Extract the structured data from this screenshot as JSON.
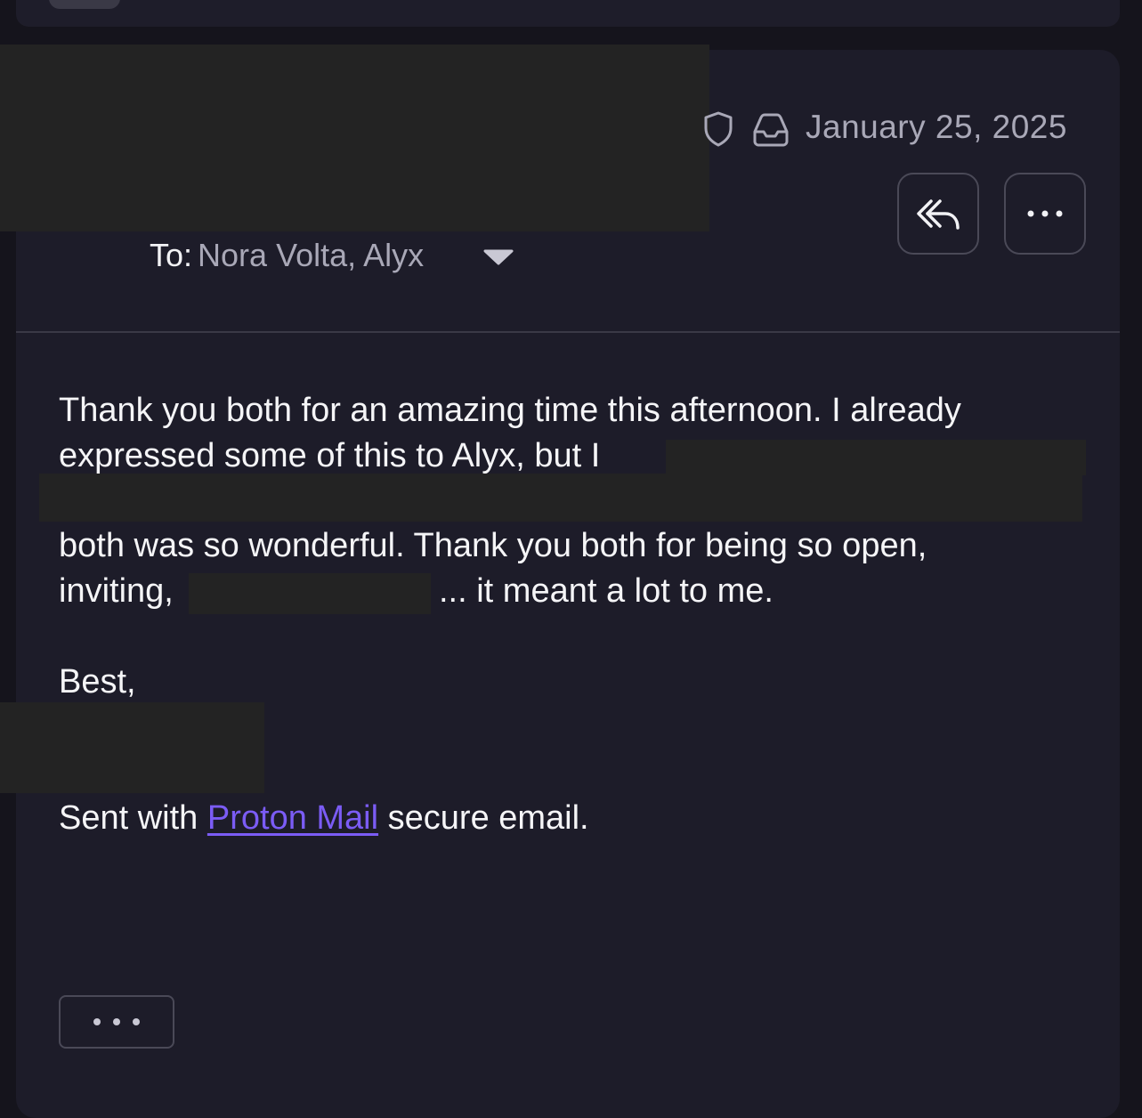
{
  "header": {
    "date": "January 25, 2025",
    "to_label": "To:",
    "to_names": "Nora Volta, Alyx"
  },
  "icons": {
    "shield": "shield-icon",
    "inbox": "inbox-icon",
    "reply_all": "reply-all-icon",
    "more": "more-horizontal-icon",
    "chevron": "chevron-down-icon"
  },
  "body": {
    "line1": "Thank you both for an amazing time this afternoon. I already",
    "line2": "expressed some of this to Alyx, but I",
    "line3": "both was so wonderful. Thank you both for being so open,",
    "line4a": "inviting,",
    "line4b": "... it meant a lot to me.",
    "closing": "Best,",
    "sig_before": "Sent with",
    "sig_link": "Proton Mail",
    "sig_after": "secure email."
  },
  "colors": {
    "background": "#1d1c29",
    "link": "#7b5cf5",
    "muted_text": "#a9a8b7",
    "redaction": "#232323"
  }
}
